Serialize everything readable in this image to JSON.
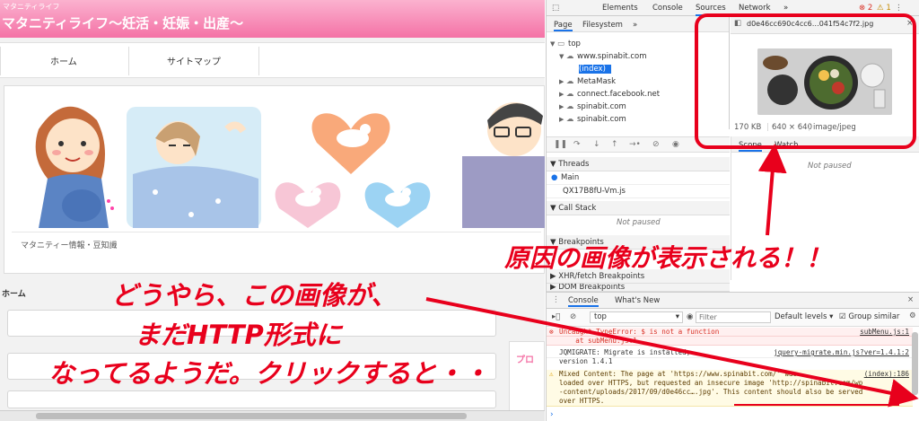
{
  "site": {
    "small_title": "マタニティライフ",
    "title": "マタニティライフ〜妊活・妊娠・出産〜",
    "nav": [
      "ホーム",
      "サイトマップ"
    ],
    "breadcrumb": "マタニティー情報・豆知識",
    "home_label": "ホーム",
    "sidebar_label": "プロ"
  },
  "devtools": {
    "top_tabs": [
      "Elements",
      "Console",
      "Sources",
      "Network",
      "»"
    ],
    "error_count": "2",
    "warn_count": "1",
    "navigator": {
      "tabs": [
        "Page",
        "Filesystem",
        "»"
      ],
      "tree": [
        "top",
        "www.spinabit.com",
        "(index)",
        "MetaMask",
        "connect.facebook.net",
        "spinabit.com",
        "spinabit.com"
      ]
    },
    "editor": {
      "file_tab": "d0e46cc690c4cc6…041f54c7f2.jpg",
      "size": "170 KB",
      "dimensions": "640 × 640",
      "mime": "image/jpeg"
    },
    "sections": {
      "threads": "Threads",
      "main": "Main",
      "thread2": "QX17B8fU-Vm.js",
      "call_stack": "Call Stack",
      "not_paused": "Not paused",
      "breakpoints": "Breakpoints",
      "xhr": "XHR/fetch Breakpoints",
      "dom": "DOM Breakpoints"
    },
    "scope": {
      "tabs": [
        "Scope",
        "Watch"
      ],
      "not_paused": "Not paused"
    },
    "console": {
      "tabs": [
        "Console",
        "What's New"
      ],
      "context": "top",
      "filter_placeholder": "Filter",
      "levels": "Default levels ▾",
      "group_similar": "Group similar",
      "lines": [
        {
          "type": "err",
          "text": "Uncaught TypeError: $ is not a function",
          "src": "subMenu.js:1"
        },
        {
          "type": "err",
          "text": "    at subMenu.js:1",
          "src": ""
        },
        {
          "type": "log",
          "text": "JQMIGRATE: Migrate is installed,",
          "src": "jquery-migrate.min.js?ver=1.4.1:2"
        },
        {
          "type": "log",
          "text": "version 1.4.1",
          "src": ""
        },
        {
          "type": "warn",
          "text": "Mixed Content: The page at 'https://www.spinabit.com/' was",
          "src": "(index):186"
        },
        {
          "type": "warn",
          "text": "loaded over HTTPS, but requested an insecure image 'http://spinabit.com/wp",
          "src": ""
        },
        {
          "type": "warn",
          "text": "-content/uploads/2017/09/d0e46cc….jpg'. This content should also be served",
          "src": ""
        },
        {
          "type": "warn",
          "text": "over HTTPS.",
          "src": ""
        }
      ],
      "prompt": "›"
    }
  },
  "annotations": {
    "right": "原因の画像が表示される！！",
    "left_line1": "どうやら、この画像が、",
    "left_line2": "まだHTTP形式に",
    "left_line3": "なってるようだ。クリックすると・・"
  },
  "colors": {
    "header_pink": "#f472a6",
    "annotation_red": "#e8001c",
    "devtools_blue": "#1a73e8"
  }
}
